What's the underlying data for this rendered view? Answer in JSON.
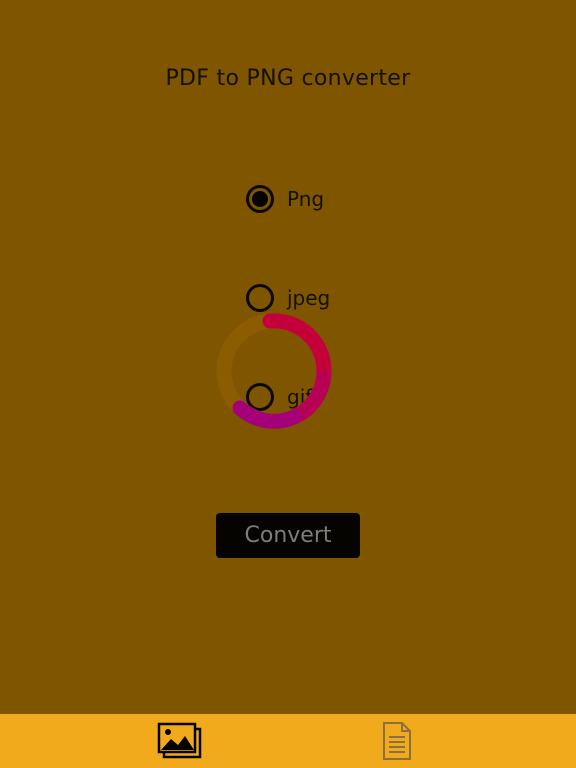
{
  "header": {
    "title": "PDF to PNG converter"
  },
  "format_options": [
    {
      "label": "Png",
      "selected": true
    },
    {
      "label": "jpeg",
      "selected": false
    },
    {
      "label": "gif",
      "selected": false
    }
  ],
  "actions": {
    "convert_label": "Convert"
  },
  "tabbar": {
    "tabs": [
      {
        "icon": "images-icon",
        "active": true
      },
      {
        "icon": "document-icon",
        "active": false
      }
    ]
  },
  "colors": {
    "background": "#7F5500",
    "tabbar": "#F1AA1B",
    "spinner_red": "#C3003A",
    "spinner_magenta": "#A5007A"
  }
}
